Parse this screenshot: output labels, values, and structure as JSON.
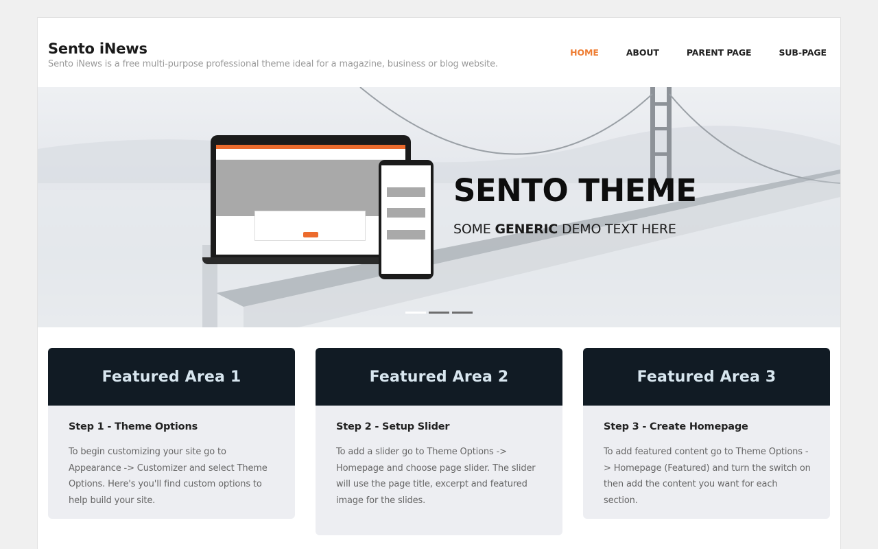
{
  "site": {
    "title": "Sento iNews",
    "description": "Sento iNews is a free multi-purpose professional theme ideal for a magazine, business or blog website."
  },
  "nav": {
    "items": [
      "HOME",
      "ABOUT",
      "PARENT PAGE",
      "SUB-PAGE"
    ],
    "active_index": 0
  },
  "hero": {
    "title": "SENTO THEME",
    "subtitle_before": "SOME ",
    "subtitle_bold": "GENERIC",
    "subtitle_after": " DEMO TEXT HERE",
    "slide_count": 3,
    "active_slide": 0
  },
  "features": [
    {
      "heading": "Featured Area 1",
      "title": "Step 1 - Theme Options",
      "text": "To begin customizing your site go to Appearance -> Customizer and select Theme Options. Here's you'll find custom options to help build your site."
    },
    {
      "heading": "Featured Area 2",
      "title": "Step 2 - Setup Slider",
      "text": "To add a slider go to Theme Options -> Homepage and choose page slider. The slider will use the page title, excerpt and featured image for the slides."
    },
    {
      "heading": "Featured Area 3",
      "title": "Step 3 - Create Homepage",
      "text": "To add featured content go to Theme Options -> Homepage (Featured) and turn the switch on then add the content you want for each section."
    }
  ],
  "colors": {
    "accent": "#ee7d33",
    "feature_header": "#111b24",
    "feature_body": "#edeef2"
  }
}
